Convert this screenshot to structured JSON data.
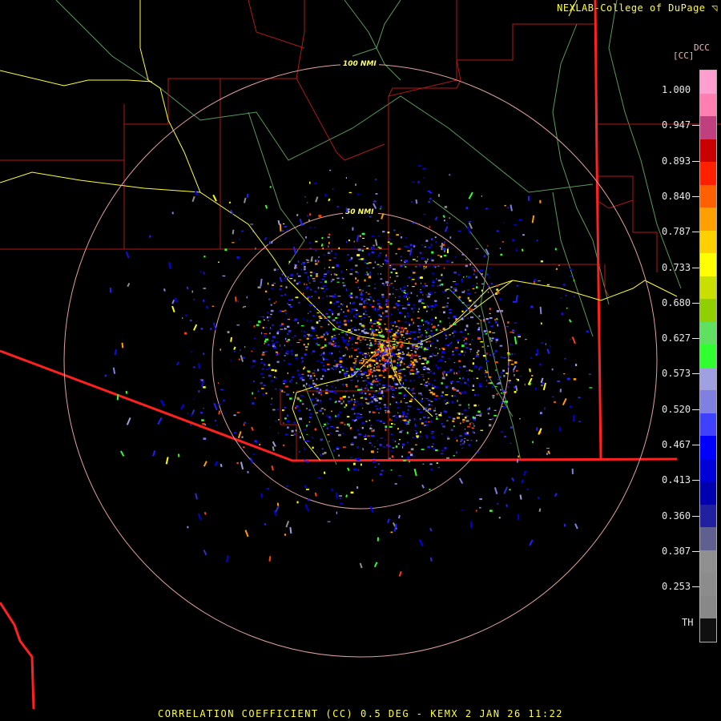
{
  "header": {
    "credit": "NEXLAB-College of DuPage",
    "credit_mark": "◹"
  },
  "legend": {
    "product": "DCC",
    "unit": "[CC]",
    "ticks": [
      "1.000",
      "0.947",
      "0.893",
      "0.840",
      "0.787",
      "0.733",
      "0.680",
      "0.627",
      "0.573",
      "0.520",
      "0.467",
      "0.413",
      "0.360",
      "0.307",
      "0.253",
      "TH"
    ],
    "colors": [
      "#ff9fcf",
      "#ff7fb0",
      "#c0407f",
      "#c80000",
      "#ff2000",
      "#ff6000",
      "#ffa000",
      "#ffd000",
      "#ffff00",
      "#c8e000",
      "#90d000",
      "#60e060",
      "#30ff30",
      "#a0a0e0",
      "#8080e0",
      "#4040ff",
      "#0000ff",
      "#0000d8",
      "#0000b0",
      "#2020a0",
      "#606090",
      "#909090",
      "#8c8c8c",
      "#888888",
      "#101010"
    ]
  },
  "map": {
    "ring_labels": [
      "100 NMI",
      "50 NMI"
    ],
    "colors": {
      "county": "#b01818",
      "state": "#ff2020",
      "highway": "#ffff33",
      "river": "#60a060",
      "ring": "#e0a0a0",
      "background": "#000000"
    }
  },
  "footer": {
    "title": "CORRELATION COEFFICIENT (CC) 0.5 DEG - KEMX 2 JAN 26 11:22"
  }
}
